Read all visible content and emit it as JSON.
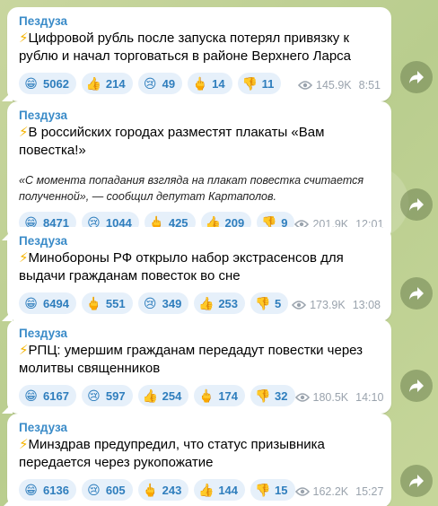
{
  "channel": "Пездуза",
  "messages": [
    {
      "bolt": "⚡",
      "text": "Цифровой рубль после запуска потерял привязку к рублю и начал торговаться в районе Верхнего Ларса",
      "quote": "",
      "reactions": [
        {
          "emoji": "😁",
          "icon": "grin-icon",
          "count": "5062"
        },
        {
          "emoji": "👍",
          "icon": "thumbs-up-icon",
          "count": "214"
        },
        {
          "emoji": "😢",
          "icon": "crying-icon",
          "count": "49"
        },
        {
          "emoji": "🖕",
          "icon": "middle-finger-icon",
          "count": "14"
        },
        {
          "emoji": "👎",
          "icon": "thumbs-down-icon",
          "count": "11"
        }
      ],
      "views": "145.9K",
      "time": "8:51"
    },
    {
      "bolt": "⚡",
      "text": "В российских городах разместят плакаты «Вам повестка!»",
      "quote": "«С момента попадания взгляда на плакат повестка считается полученной», — сообщил депутат Картаполов.",
      "reactions": [
        {
          "emoji": "😁",
          "icon": "grin-icon",
          "count": "8471"
        },
        {
          "emoji": "😢",
          "icon": "crying-icon",
          "count": "1044"
        },
        {
          "emoji": "🖕",
          "icon": "middle-finger-icon",
          "count": "425"
        },
        {
          "emoji": "👍",
          "icon": "thumbs-up-icon",
          "count": "209"
        },
        {
          "emoji": "👎",
          "icon": "thumbs-down-icon",
          "count": "9"
        }
      ],
      "views": "201.9K",
      "time": "12:01"
    },
    {
      "bolt": "⚡",
      "text": "Минобороны РФ открыло набор экстрасенсов для выдачи гражданам повесток во сне",
      "quote": "",
      "reactions": [
        {
          "emoji": "😁",
          "icon": "grin-icon",
          "count": "6494"
        },
        {
          "emoji": "🖕",
          "icon": "middle-finger-icon",
          "count": "551"
        },
        {
          "emoji": "😢",
          "icon": "crying-icon",
          "count": "349"
        },
        {
          "emoji": "👍",
          "icon": "thumbs-up-icon",
          "count": "253"
        },
        {
          "emoji": "👎",
          "icon": "thumbs-down-icon",
          "count": "5"
        }
      ],
      "views": "173.9K",
      "time": "13:08"
    },
    {
      "bolt": "⚡",
      "text": "РПЦ: умершим гражданам передадут повестки через молитвы священников",
      "quote": "",
      "reactions": [
        {
          "emoji": "😁",
          "icon": "grin-icon",
          "count": "6167"
        },
        {
          "emoji": "😢",
          "icon": "crying-icon",
          "count": "597"
        },
        {
          "emoji": "👍",
          "icon": "thumbs-up-icon",
          "count": "254"
        },
        {
          "emoji": "🖕",
          "icon": "middle-finger-icon",
          "count": "174"
        },
        {
          "emoji": "👎",
          "icon": "thumbs-down-icon",
          "count": "32"
        }
      ],
      "views": "180.5K",
      "time": "14:10"
    },
    {
      "bolt": "⚡",
      "text": "Минздрав предупредил, что статус призывника передается через рукопожатие",
      "quote": "",
      "reactions": [
        {
          "emoji": "😁",
          "icon": "grin-icon",
          "count": "6136"
        },
        {
          "emoji": "😢",
          "icon": "crying-icon",
          "count": "605"
        },
        {
          "emoji": "🖕",
          "icon": "middle-finger-icon",
          "count": "243"
        },
        {
          "emoji": "👍",
          "icon": "thumbs-up-icon",
          "count": "144"
        },
        {
          "emoji": "👎",
          "icon": "thumbs-down-icon",
          "count": "15"
        }
      ],
      "views": "162.2K",
      "time": "15:27"
    }
  ]
}
